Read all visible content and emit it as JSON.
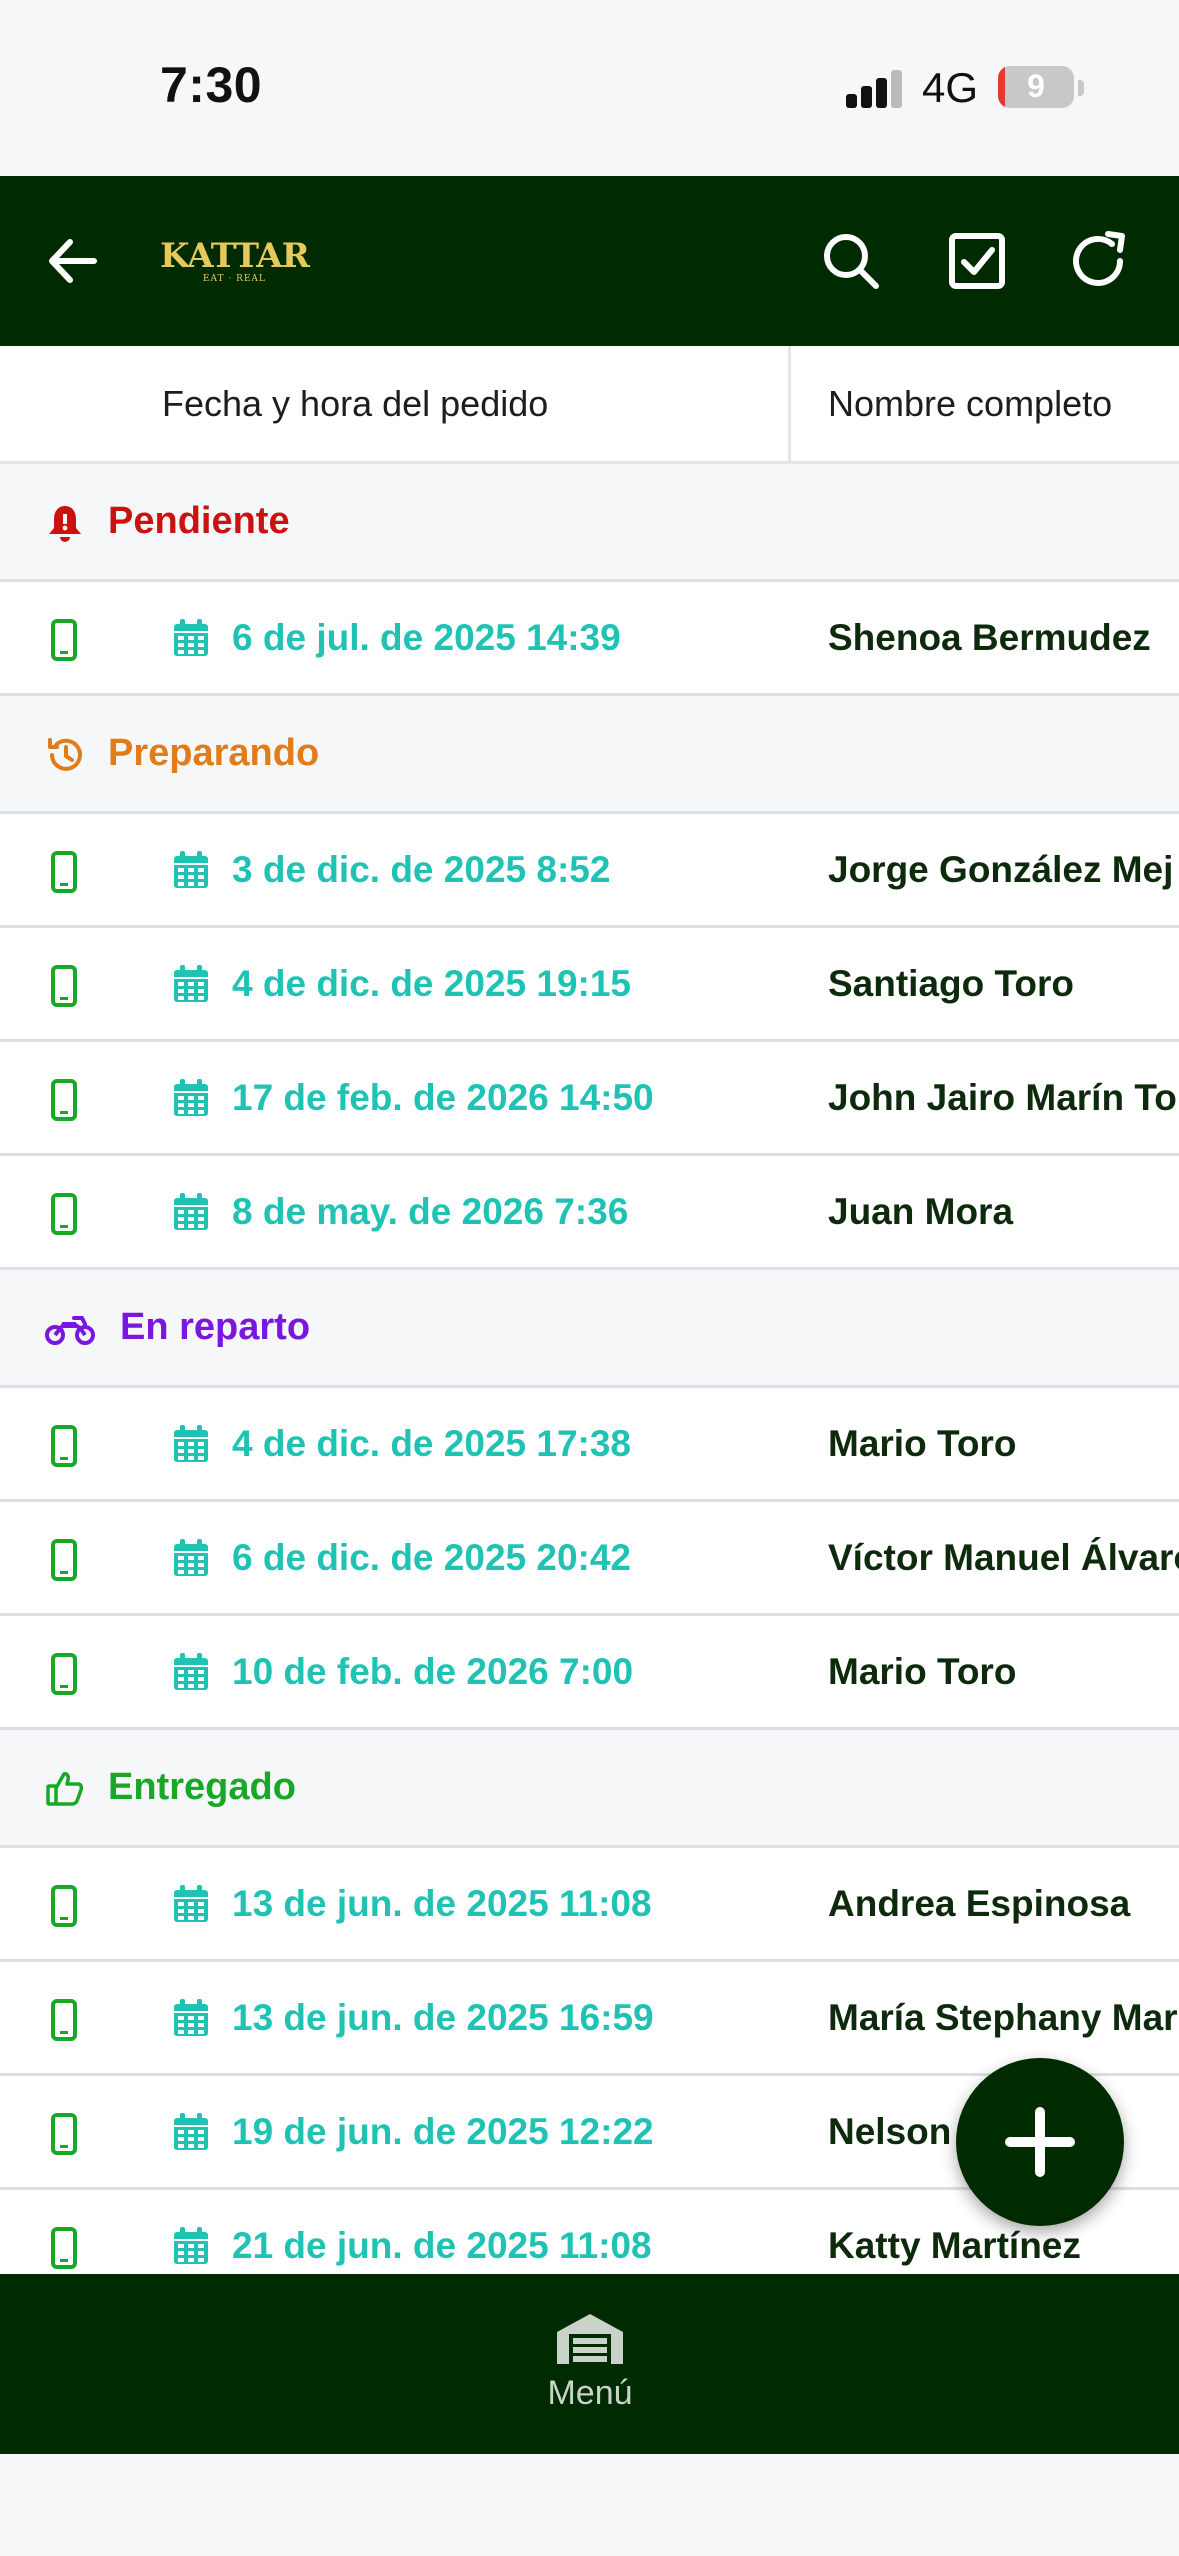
{
  "status_bar": {
    "time": "7:30",
    "network": "4G",
    "battery": "9",
    "battery_level": 0.09
  },
  "app_bar": {
    "logo_text": "KATTAR",
    "logo_tagline": "EAT · REAL",
    "icons": [
      "back-arrow-icon",
      "search-icon",
      "checkbox-icon",
      "refresh-icon"
    ]
  },
  "table": {
    "columns": [
      "Fecha y hora del pedido",
      "Nombre completo"
    ],
    "groups": [
      {
        "label": "Pendiente",
        "icon": "bell-icon",
        "color": "#cc1111",
        "rows": [
          {
            "date": "6 de jul. de 2025 14:39",
            "name": "Shenoa Bermudez"
          }
        ]
      },
      {
        "label": "Preparando",
        "icon": "history-icon",
        "color": "#e07c1a",
        "rows": [
          {
            "date": "3 de dic. de 2025 8:52",
            "name": "Jorge González Mej"
          },
          {
            "date": "4 de dic. de 2025 19:15",
            "name": "Santiago Toro"
          },
          {
            "date": "17 de feb. de 2026 14:50",
            "name": "John Jairo Marín To"
          },
          {
            "date": "8 de may. de 2026 7:36",
            "name": "Juan Mora"
          }
        ]
      },
      {
        "label": "En reparto",
        "icon": "motorcycle-icon",
        "color": "#7b16e0",
        "rows": [
          {
            "date": "4 de dic. de 2025 17:38",
            "name": "Mario Toro"
          },
          {
            "date": "6 de dic. de 2025 20:42",
            "name": "Víctor Manuel Álvaro"
          },
          {
            "date": "10 de feb. de 2026 7:00",
            "name": "Mario Toro"
          }
        ]
      },
      {
        "label": "Entregado",
        "icon": "thumbs-up-icon",
        "color": "#18a828",
        "rows": [
          {
            "date": "13 de jun. de 2025 11:08",
            "name": "Andrea Espinosa"
          },
          {
            "date": "13 de jun. de 2025 16:59",
            "name": "María Stephany Mar"
          },
          {
            "date": "19 de jun. de 2025 12:22",
            "name": "Nelson"
          },
          {
            "date": "21 de jun. de 2025 11:08",
            "name": "Katty Martínez"
          }
        ]
      }
    ]
  },
  "fab": {
    "icon": "plus-icon"
  },
  "bottom_nav": {
    "items": [
      {
        "label": "Menú",
        "icon": "warehouse-icon"
      }
    ]
  },
  "colors": {
    "primary": "#002b00",
    "date_text": "#20c2b4",
    "device_icon": "#18a828"
  }
}
